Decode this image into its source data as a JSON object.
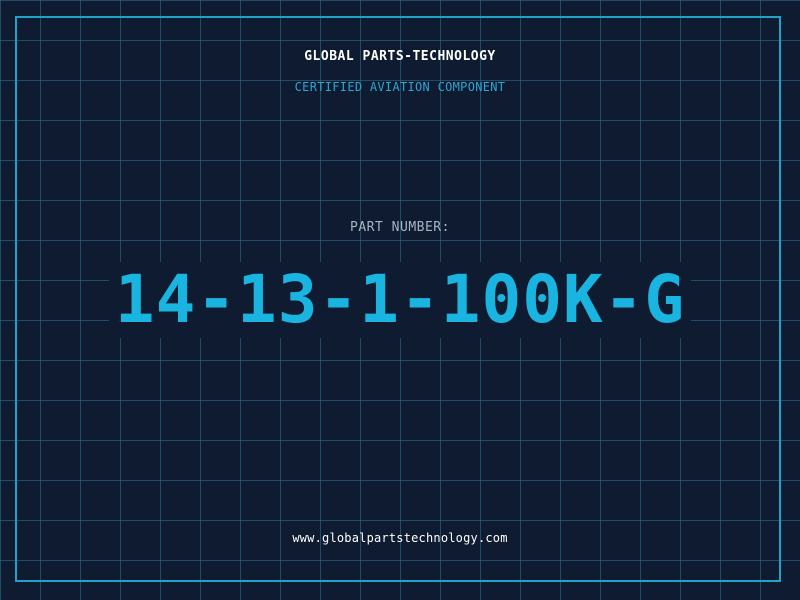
{
  "header": {
    "company": "GLOBAL PARTS-TECHNOLOGY",
    "subtitle": "CERTIFIED AVIATION COMPONENT"
  },
  "part": {
    "label": "PART NUMBER:",
    "number": "14-13-1-100K-G"
  },
  "footer": {
    "website": "www.globalpartstechnology.com"
  },
  "colors": {
    "background": "#0f1b30",
    "grid": "#28788f",
    "accent": "#21a3c9",
    "part_number": "#19b4df",
    "label": "#a8b4c4",
    "text": "#ffffff"
  }
}
